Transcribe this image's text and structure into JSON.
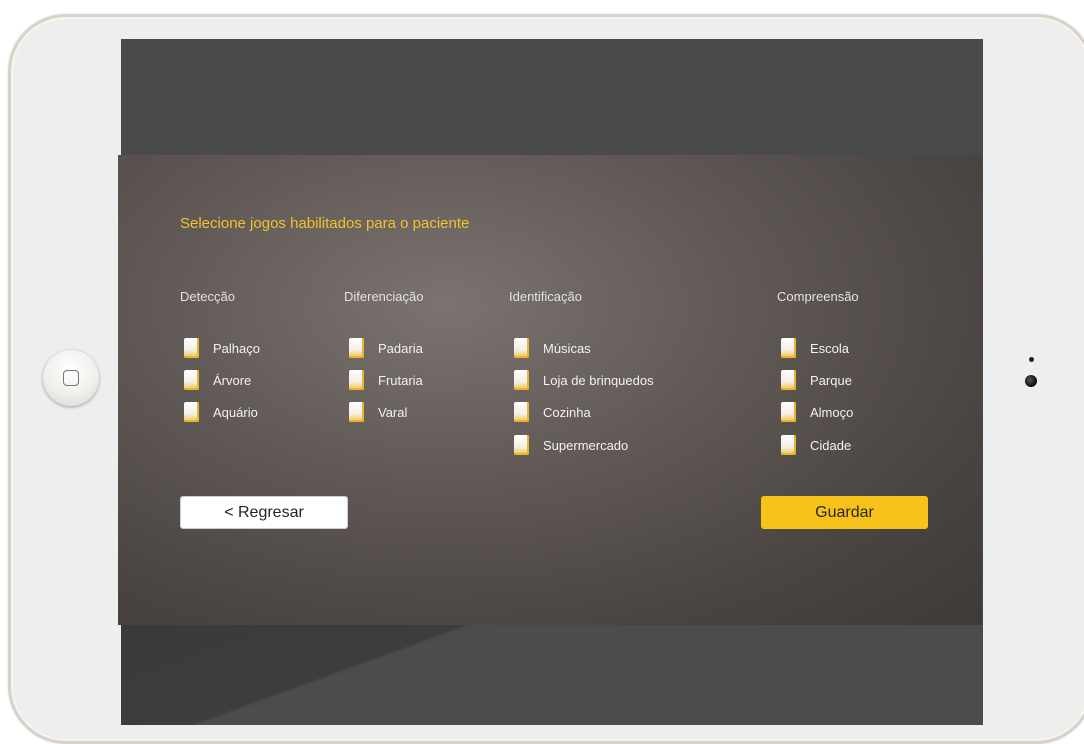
{
  "panel": {
    "title": "Selecione jogos habilitados para o paciente"
  },
  "categories": [
    {
      "label": "Detecção",
      "options": [
        "Palhaço",
        "Árvore",
        "Aquário"
      ]
    },
    {
      "label": "Diferenciação",
      "options": [
        "Padaria",
        "Frutaria",
        "Varal"
      ]
    },
    {
      "label": "Identificação",
      "options": [
        "Músicas",
        "Loja de brinquedos",
        "Cozinha",
        "Supermercado"
      ]
    },
    {
      "label": "Compreensão",
      "options": [
        "Escola",
        "Parque",
        "Almoço",
        "Cidade"
      ]
    }
  ],
  "buttons": {
    "back_label": "< Regresar",
    "save_label": "Guardar"
  },
  "colors": {
    "accent": "#f7c31a",
    "title": "#f2c12e"
  },
  "icons": {
    "home_button": "home-button-icon",
    "camera": "camera-icon"
  }
}
